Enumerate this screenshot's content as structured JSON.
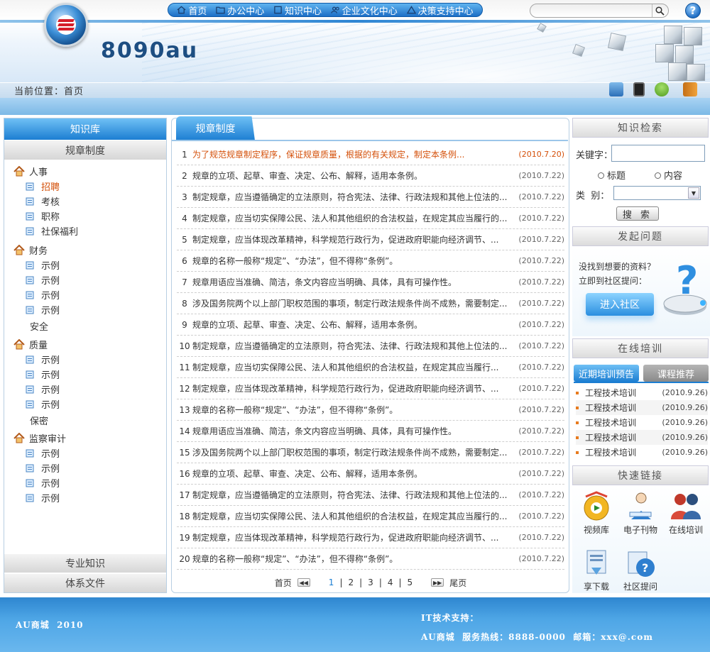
{
  "site": {
    "name": "8090au"
  },
  "topnav": [
    "首页",
    "办公中心",
    "知识中心",
    "企业文化中心",
    "决策支持中心"
  ],
  "breadcrumb": "当前位置：首页",
  "left": {
    "title": "知识库",
    "section": "规章制度",
    "groups": [
      {
        "label": "人事",
        "items": [
          "招聘",
          "考核",
          "职称",
          "社保福利"
        ],
        "active": "招聘"
      },
      {
        "label": "财务",
        "items": [
          "示例",
          "示例",
          "示例",
          "示例"
        ],
        "extra": "安全"
      },
      {
        "label": "质量",
        "items": [
          "示例",
          "示例",
          "示例",
          "示例"
        ],
        "extra": "保密"
      },
      {
        "label": "监察审计",
        "items": [
          "示例",
          "示例",
          "示例",
          "示例"
        ]
      }
    ],
    "bottom": [
      "专业知识",
      "体系文件"
    ]
  },
  "center": {
    "tab": "规章制度",
    "rows": [
      {
        "n": "1",
        "text": "为了规范规章制定程序，保证规章质量，根据的有关规定，制定本条例...",
        "date": "(2010.7.20)"
      },
      {
        "n": "2",
        "text": "规章的立项、起草、审查、决定、公布、解释，适用本条例。",
        "date": "(2010.7.22)"
      },
      {
        "n": "3",
        "text": "制定规章，应当遵循确定的立法原则，符合宪法、法律、行政法规和其他上位法的...",
        "date": "(2010.7.22)"
      },
      {
        "n": "4",
        "text": "制定规章，应当切实保障公民、法人和其他组织的合法权益，在规定其应当履行的...",
        "date": "(2010.7.22)"
      },
      {
        "n": "5",
        "text": "制定规章，应当体现改革精神，科学规范行政行为，促进政府职能向经济调节、...",
        "date": "(2010.7.22)"
      },
      {
        "n": "6",
        "text": "规章的名称一般称“规定”、“办法”，但不得称“条例”。",
        "date": "(2010.7.22)"
      },
      {
        "n": "7",
        "text": "规章用语应当准确、简洁，条文内容应当明确、具体，具有可操作性。",
        "date": "(2010.7.22)"
      },
      {
        "n": "8",
        "text": "涉及国务院两个以上部门职权范围的事项，制定行政法规条件尚不成熟，需要制定...",
        "date": "(2010.7.22)"
      },
      {
        "n": "9",
        "text": "规章的立项、起草、审查、决定、公布、解释，适用本条例。",
        "date": "(2010.7.22)"
      },
      {
        "n": "10",
        "text": "制定规章，应当遵循确定的立法原则，符合宪法、法律、行政法规和其他上位法的...",
        "date": "(2010.7.22)"
      },
      {
        "n": "11",
        "text": "制定规章，应当切实保障公民、法人和其他组织的合法权益，在规定其应当履行...",
        "date": "(2010.7.22)"
      },
      {
        "n": "12",
        "text": "制定规章，应当体现改革精神，科学规范行政行为，促进政府职能向经济调节、...",
        "date": "(2010.7.22)"
      },
      {
        "n": "13",
        "text": "规章的名称一般称“规定”、“办法”，但不得称“条例”。",
        "date": "(2010.7.22)"
      },
      {
        "n": "14",
        "text": "规章用语应当准确、简洁，条文内容应当明确、具体，具有可操作性。",
        "date": "(2010.7.22)"
      },
      {
        "n": "15",
        "text": "涉及国务院两个以上部门职权范围的事项，制定行政法规条件尚不成熟，需要制定...",
        "date": "(2010.7.22)"
      },
      {
        "n": "16",
        "text": "规章的立项、起草、审查、决定、公布、解释，适用本条例。",
        "date": "(2010.7.22)"
      },
      {
        "n": "17",
        "text": "制定规章，应当遵循确定的立法原则，符合宪法、法律、行政法规和其他上位法的...",
        "date": "(2010.7.22)"
      },
      {
        "n": "18",
        "text": "制定规章，应当切实保障公民、法人和其他组织的合法权益，在规定其应当履行的...",
        "date": "(2010.7.22)"
      },
      {
        "n": "19",
        "text": "制定规章，应当体现改革精神，科学规范行政行为，促进政府职能向经济调节、...",
        "date": "(2010.7.22)"
      },
      {
        "n": "20",
        "text": "规章的名称一般称“规定”、“办法”，但不得称“条例”。",
        "date": "(2010.7.22)"
      }
    ],
    "pager": {
      "first": "首页",
      "pages": [
        "1",
        "2",
        "3",
        "4",
        "5"
      ],
      "current": "1",
      "last": "尾页"
    }
  },
  "right": {
    "search": {
      "title": "知识检索",
      "kw_label": "关键字：",
      "kw_value": "",
      "radio_title": "标题",
      "radio_content": "内容",
      "cat_label": "类  别：",
      "cat_value": "",
      "button": "搜 索"
    },
    "ask": {
      "title": "发起问题",
      "line1": "没找到想要的资料？",
      "line2": "立即到社区提问：",
      "button": "进入社区"
    },
    "training": {
      "title": "在线培训",
      "tab_active": "近期培训预告",
      "tab_other": "课程推荐",
      "items": [
        {
          "t": "工程技术培训",
          "d": "(2010.9.26)"
        },
        {
          "t": "工程技术培训",
          "d": "(2010.9.26)"
        },
        {
          "t": "工程技术培训",
          "d": "(2010.9.26)"
        },
        {
          "t": "工程技术培训",
          "d": "(2010.9.26)"
        },
        {
          "t": "工程技术培训",
          "d": "(2010.9.26)"
        }
      ]
    },
    "quick": {
      "title": "快速链接",
      "links": [
        "视频库",
        "电子刊物",
        "在线培训",
        "享下载",
        "社区提问"
      ]
    }
  },
  "footer": {
    "left": "AU商城  2010",
    "support": "IT技术支持：",
    "contact": "AU商城  服务热线：8888-0000  邮箱：xxx@.com"
  },
  "colors": {
    "accent": "#1c7ed2",
    "highlight": "#d4500a",
    "footer": "#3a93dc"
  }
}
